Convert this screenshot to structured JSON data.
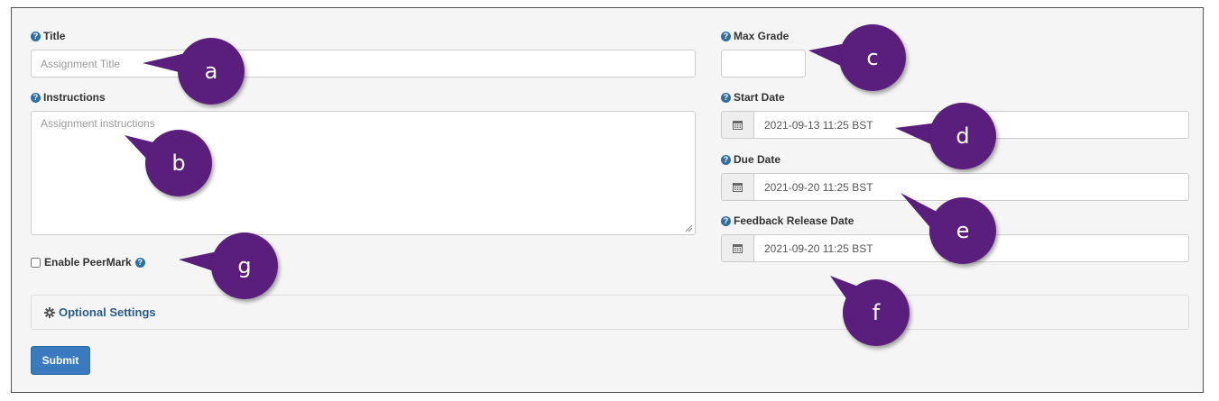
{
  "form": {
    "title": {
      "label": "Title",
      "placeholder": "Assignment Title",
      "help_icon": "question-circle-icon"
    },
    "instructions": {
      "label": "Instructions",
      "placeholder": "Assignment instructions",
      "help_icon": "question-circle-icon"
    },
    "peermark": {
      "label": "Enable PeerMark",
      "checked": false,
      "help_icon": "question-circle-icon"
    },
    "max_grade": {
      "label": "Max Grade",
      "value": "",
      "help_icon": "question-circle-icon"
    },
    "start_date": {
      "label": "Start Date",
      "value": "2021-09-13 11:25 BST",
      "icon": "calendar-icon"
    },
    "due_date": {
      "label": "Due Date",
      "value": "2021-09-20 11:25 BST",
      "icon": "calendar-icon"
    },
    "feedback_release_date": {
      "label": "Feedback Release Date",
      "value": "2021-09-20 11:25 BST",
      "icon": "calendar-icon"
    },
    "optional_settings": {
      "label": "Optional Settings",
      "icon": "gear-icon"
    },
    "submit_label": "Submit"
  },
  "help_glyph": "?",
  "callouts": {
    "a": "a",
    "b": "b",
    "c": "c",
    "d": "d",
    "e": "e",
    "f": "f",
    "g": "g"
  },
  "colors": {
    "callout": "#5a1f7c",
    "submit": "#3a7bc0",
    "help": "#2f6fa7",
    "link": "#2a5d8c",
    "panel": "#f5f5f5"
  }
}
